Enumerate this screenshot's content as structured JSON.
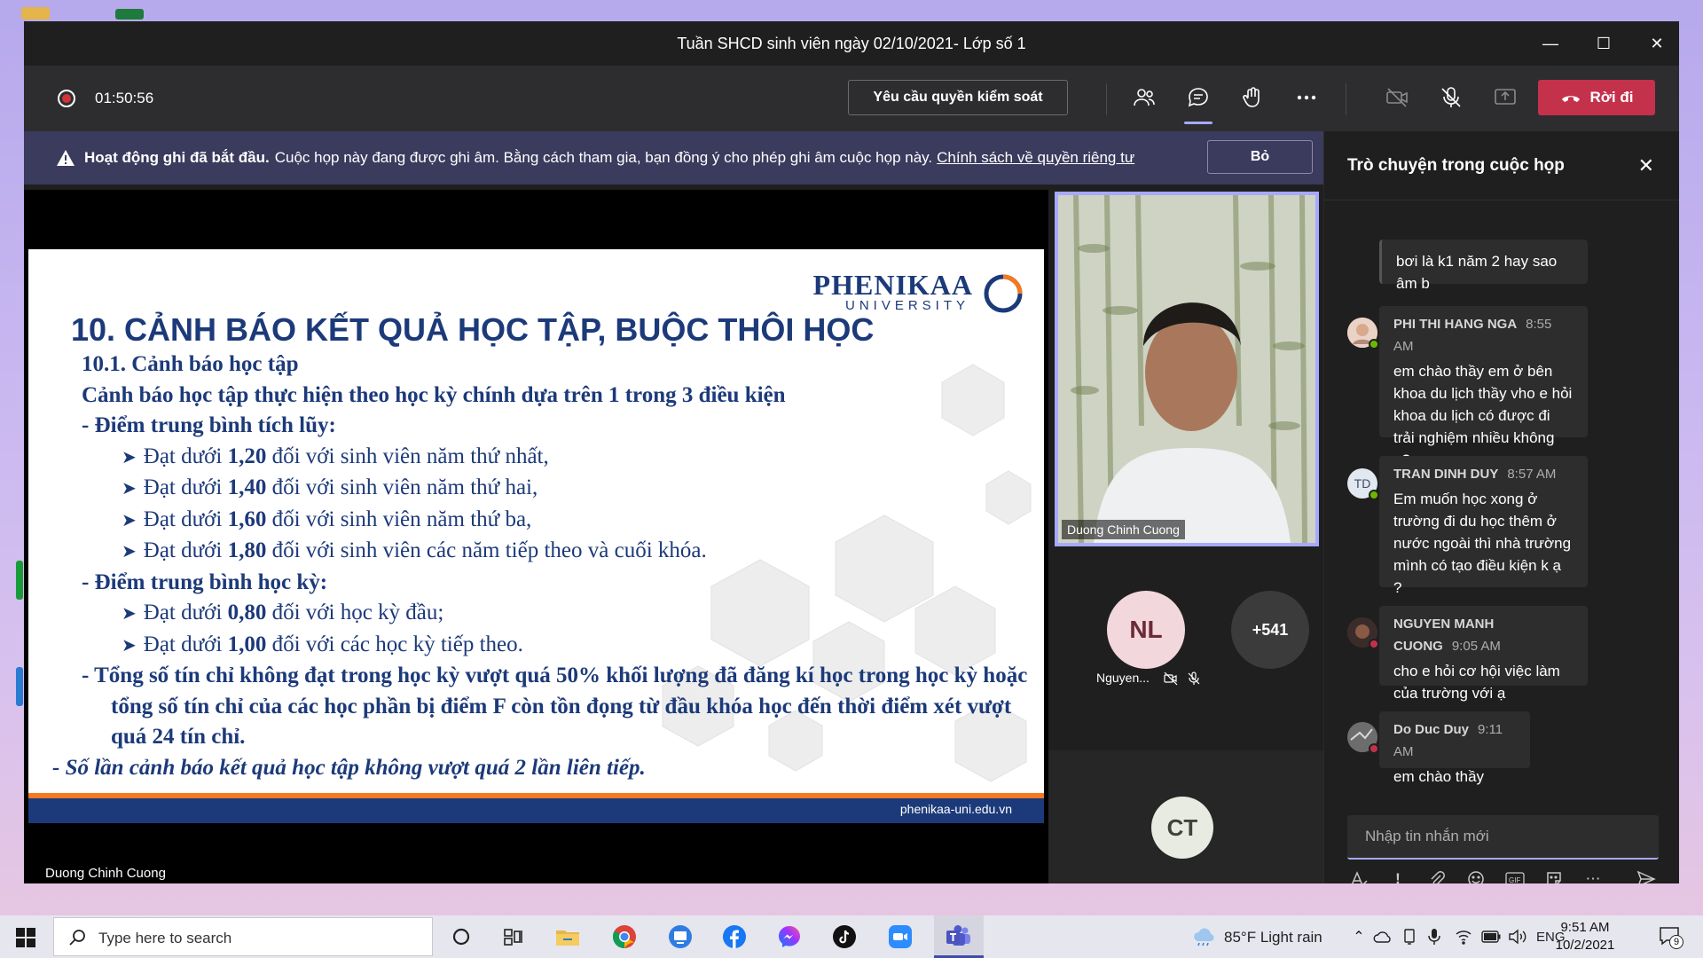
{
  "window": {
    "title": "Tuần SHCD sinh viên ngày 02/10/2021- Lớp số 1"
  },
  "toolbar": {
    "timer": "01:50:56",
    "request_control": "Yêu cầu quyền kiểm soát",
    "leave": "Rời đi"
  },
  "banner": {
    "bold": "Hoạt động ghi đã bắt đầu.",
    "text": "Cuộc họp này đang được ghi âm. Bằng cách tham gia, bạn đồng ý cho phép ghi âm cuộc họp này.",
    "link": "Chính sách về quyền riêng tư",
    "dismiss": "Bỏ"
  },
  "slide": {
    "logo_main": "PHENIKAA",
    "logo_sub": "UNIVERSITY",
    "title": "10. CẢNH BÁO KẾT QUẢ HỌC TẬP, BUỘC THÔI HỌC",
    "lines": {
      "l1": "10.1. Cảnh báo học tập",
      "l2": "Cảnh báo học tập thực hiện theo học kỳ chính dựa trên 1 trong 3 điều kiện",
      "l3": "- Điểm trung bình tích lũy:",
      "l4a": "Đạt dưới ",
      "l4b": "1,20",
      "l4c": " đối với sinh viên năm thứ nhất,",
      "l5a": "Đạt dưới ",
      "l5b": "1,40",
      "l5c": " đối với sinh viên năm thứ hai,",
      "l6a": "Đạt dưới ",
      "l6b": "1,60",
      "l6c": " đối với sinh viên năm thứ ba,",
      "l7a": "Đạt dưới ",
      "l7b": "1,80",
      "l7c": " đối với sinh viên các năm tiếp theo và cuối khóa.",
      "l8": "- Điểm trung bình học kỳ:",
      "l9a": "Đạt dưới ",
      "l9b": "0,80",
      "l9c": " đối với học kỳ đầu;",
      "l10a": "Đạt dưới ",
      "l10b": "1,00",
      "l10c": " đối với các học kỳ tiếp theo.",
      "l11": "-   Tổng số tín chỉ không đạt trong học kỳ vượt quá 50% khối lượng đã đăng kí học trong học kỳ hoặc tổng số tín chỉ của các học phần bị điểm F còn tồn đọng từ đầu khóa học đến thời điểm xét vượt quá 24 tín chỉ.",
      "l12": "-   Số lần cảnh báo kết quả học tập không vượt quá 2 lần liên tiếp."
    },
    "footer_url": "phenikaa-uni.edu.vn"
  },
  "presenter": {
    "name": "Duong Chinh Cuong"
  },
  "participants": {
    "video_name": "Duong Chinh Cuong",
    "nl_initials": "NL",
    "nl_name": "Nguyen...",
    "more": "+541",
    "ct_initials": "CT"
  },
  "chat": {
    "title": "Trò chuyện trong cuộc họp",
    "messages": [
      {
        "text": "bơi là k1 năm 2 hay sao âm b"
      },
      {
        "name": "PHI THI HANG NGA",
        "time": "8:55 AM",
        "text": "em chào thầy em ở bên khoa du lịch thầy vho e hỏi khoa du lịch có được đi trải nghiệm nhiều không ạ?"
      },
      {
        "name": "TRAN DINH DUY",
        "time": "8:57 AM",
        "initials": "TD",
        "text": "Em muốn học xong ở trường đi du học thêm ở nước ngoài thì nhà trường mình có tạo điều kiện k ạ ?"
      },
      {
        "name": "NGUYEN MANH CUONG",
        "time": "9:05 AM",
        "text": "cho e hỏi cơ hội việc làm của trường với ạ"
      },
      {
        "name": "Do Duc Duy",
        "time": "9:11 AM",
        "text": "em chào thầy"
      }
    ],
    "placeholder": "Nhập tin nhắn mới"
  },
  "taskbar": {
    "search": "Type here to search",
    "weather": "85°F  Light rain",
    "lang": "ENG",
    "time": "9:51 AM",
    "date": "10/2/2021",
    "notif_count": "9"
  },
  "colors": {
    "accent": "#a7a9ff",
    "leave": "#c4314b",
    "slide_blue": "#1c3a7a",
    "slide_orange": "#f47920"
  }
}
